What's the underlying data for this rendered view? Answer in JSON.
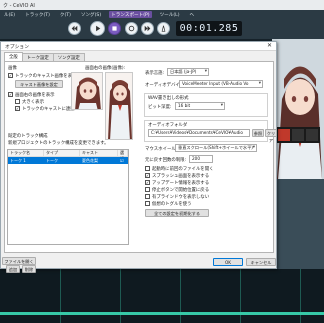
{
  "app": {
    "title": "ク - CeVIO AI",
    "menu": [
      "ル(E)",
      "トラック(T)",
      "ク(T)",
      "ソング(S)",
      "トランスポート(P)",
      "ツール(L)",
      "ヘ"
    ],
    "active_menu": 4,
    "time": "00:01.285",
    "bottom_button": "ファイルを開く"
  },
  "dialog": {
    "title": "オプション",
    "close_glyph": "✕",
    "tabs": [
      "全般",
      "トーク設定",
      "ソング設定"
    ],
    "active_tab": 0,
    "image_section": {
      "header": "画像",
      "chk_show_track_image": "トラックのキャスト画像を表示",
      "btn_cast_image_settings": "キャスト画像を設定",
      "chk_show_image_on_screen": "画面右の画像を表示",
      "chk_large_display": "大きく表示",
      "chk_link_track_cast": "トラックのキャストに連動",
      "preview_label": "画面右の画像(画像):"
    },
    "track_section": {
      "header": "既定のトラック構成",
      "description": "新規プロジェクトのトラック構成を変更できます。",
      "columns": [
        "トラック名",
        "タイプ",
        "キャスト",
        "選択"
      ],
      "rows": [
        [
          "トーク 1",
          "トーク",
          "夏色花梨",
          "☑"
        ]
      ],
      "btn_add": "追加",
      "btn_delete": "削除"
    },
    "display": {
      "display_language_label": "表示言語:",
      "display_language_value": "日本語 (ja-JP)",
      "audio_device_label": "オーディオデバイス:",
      "audio_device_value": "VoiceMeeter Input (VB-Audio Vo",
      "wav_format_header": "WAV書き出しの形式",
      "bit_depth_label": "ビット深度:",
      "bit_depth_value": "16 bit",
      "audio_folder_header": "オーディオフォルダ",
      "audio_folder_path": "C:¥Users¥Videos¥Documents¥CeVIO¥Audio",
      "btn_browse": "参照",
      "btn_clear": "クリア",
      "mouse_wheel_label": "マウスホイール:",
      "mouse_wheel_value": "垂直スクロール(Shift+ホイールで水平)",
      "undo_limit_label": "元に戻す回数の制限:",
      "undo_limit_value": "200",
      "options": [
        {
          "label": "起動時に前回のファイルを開く",
          "checked": false
        },
        {
          "label": "スプラッシュ画面を表示する",
          "checked": true
        },
        {
          "label": "アップデート情報を表示する",
          "checked": true
        },
        {
          "label": "停止ボタンで開始位置に戻る",
          "checked": false
        },
        {
          "label": "有プラインドウを表示しない",
          "checked": false
        },
        {
          "label": "仮想のトグルを使う",
          "checked": false
        }
      ],
      "btn_reset_all": "全ての設定を初期化する"
    },
    "btn_ok": "OK",
    "btn_cancel": "キャンセル"
  },
  "colors": {
    "accent": "#0078d7",
    "menu_active": "#6a4fa0",
    "app_bg": "#17242b",
    "wave": "#37c9a8"
  }
}
